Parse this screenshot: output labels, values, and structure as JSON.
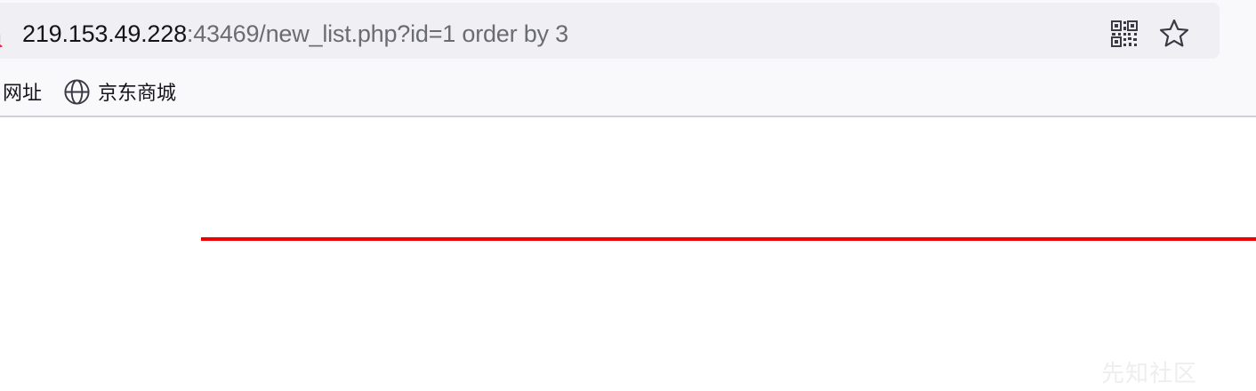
{
  "url": {
    "host": "219.153.49.228",
    "rest": ":43469/new_list.php?id=1 order by 3"
  },
  "bookmarks": [
    {
      "label": "网址",
      "icon": null
    },
    {
      "label": "京东商城",
      "icon": "globe-icon"
    }
  ],
  "watermark": "先知社区",
  "colors": {
    "chrome_bg": "#f9f9fb",
    "url_bar_bg": "#f0f0f4",
    "divider": "#cfcfd8",
    "rule": "#ee0000",
    "lock_slash": "#e22850"
  },
  "icons": [
    "insecure-lock-icon",
    "qr-code-icon",
    "bookmark-star-icon",
    "globe-icon"
  ]
}
